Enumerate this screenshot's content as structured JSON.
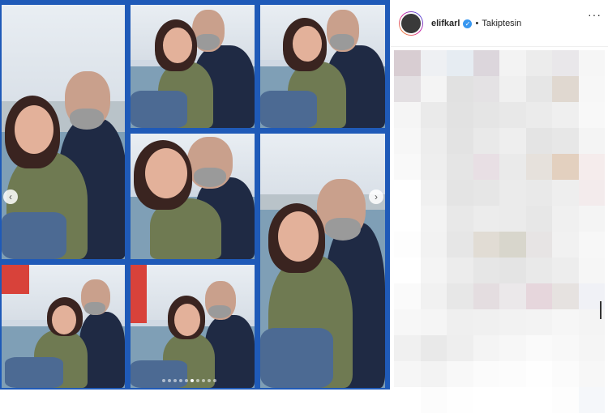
{
  "post": {
    "username": "elifkarl",
    "separator": "•",
    "follow_status": "Takiptesin",
    "more_label": "···"
  },
  "icons": {
    "verified": "verified-badge-icon",
    "prev": "chevron-left-icon",
    "next": "chevron-right-icon"
  },
  "colors": {
    "collage_border": "#1f5ab8",
    "verified": "#3897f0"
  },
  "carousel": {
    "total_slides": 10,
    "active_index": 5,
    "prev_glyph": "‹",
    "next_glyph": "›"
  },
  "mosaic_colors": [
    "#d8cdd2",
    "#eef0f3",
    "#e6ecf2",
    "#dcd6dc",
    "#f3f3f3",
    "#ececec",
    "#e9e7ea",
    "#f6f6f6",
    "#e3dfe2",
    "#f4f4f4",
    "#e1e1e1",
    "#e4e2e4",
    "#f0f0f0",
    "#e6e6e6",
    "#e0d8d0",
    "#f7f7f7",
    "#f5f5f5",
    "#eaeaea",
    "#e2e2e2",
    "#e5e5e5",
    "#e8e8e8",
    "#ebebeb",
    "#efefef",
    "#f8f8f8",
    "#f7f7f7",
    "#ededed",
    "#e3e3e3",
    "#e9e9e9",
    "#eeeeee",
    "#e4e4e4",
    "#e7e7e7",
    "#f4f4f4",
    "#f9f9f9",
    "#eeeeee",
    "#e5e5e5",
    "#e8dfe4",
    "#eaeaea",
    "#e6e1dc",
    "#e3d0bf",
    "#f5ecec",
    "#ffffff",
    "#f0f0f0",
    "#e4e4e4",
    "#e6e6e6",
    "#ebebeb",
    "#e9e9e9",
    "#eeeeee",
    "#f3ebec",
    "#ffffff",
    "#f3f3f3",
    "#e8e8e8",
    "#ececec",
    "#ebebeb",
    "#e7e7e7",
    "#f0f0f0",
    "#f4f4f4",
    "#fdfdfd",
    "#f2f2f2",
    "#e6e6e6",
    "#e1dcd4",
    "#d8d6cc",
    "#e7e4e4",
    "#f1f1f1",
    "#f7f7f7",
    "#ffffff",
    "#f4f4f4",
    "#ececec",
    "#e6e6e6",
    "#e4e4e4",
    "#e9e9e9",
    "#ededed",
    "#f6f6f6",
    "#fafafa",
    "#f1f1f1",
    "#e7e7e7",
    "#e4dde0",
    "#ebe8ea",
    "#e6d6dc",
    "#e6e2e0",
    "#f0f1f6",
    "#f7f7f7",
    "#f5f5f5",
    "#efefef",
    "#f0f0f0",
    "#f2f2f2",
    "#f3f3f3",
    "#f6f6f6",
    "#f4f4f4",
    "#f0f0f0",
    "#e9e9e9",
    "#eeeeee",
    "#f4f4f4",
    "#f7f7f7",
    "#fafafa",
    "#f8f8f8",
    "#f5f5f5",
    "#f6f6f6",
    "#f3f3f3",
    "#f8f8f8",
    "#fbfbfb",
    "#fcfcfc",
    "#fefefe",
    "#fbfbfb",
    "#f7f7f7",
    "#ffffff",
    "#fcfcfc",
    "#fefefe",
    "#ffffff",
    "#ffffff",
    "#ffffff",
    "#fdfdfd",
    "#f5f7fa"
  ]
}
